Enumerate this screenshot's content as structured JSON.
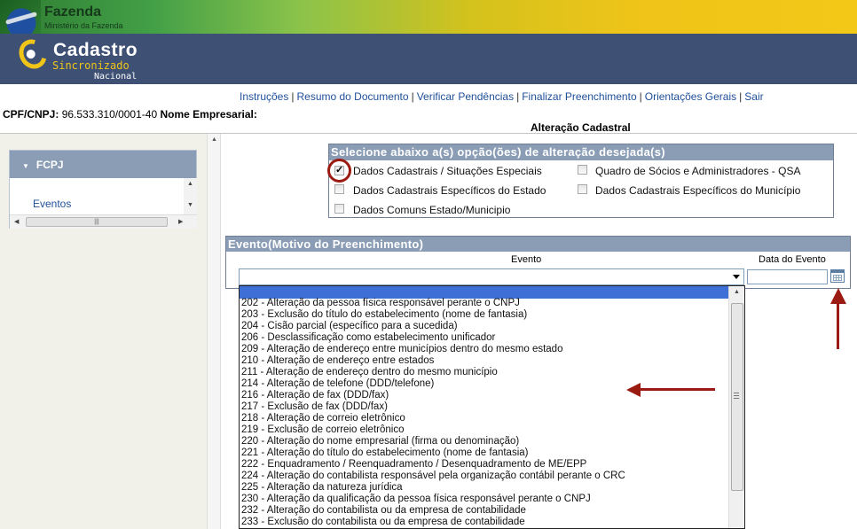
{
  "header": {
    "gov_title": "Fazenda",
    "gov_subtitle": "Ministério da Fazenda",
    "logo_line1": "Cadastro",
    "logo_line2": "Sincronizado",
    "logo_line3": "Nacional"
  },
  "nav": [
    "Instruções",
    "Resumo do Documento",
    "Verificar Pendências",
    "Finalizar Preenchimento",
    "Orientações Gerais",
    "Sair"
  ],
  "info": {
    "cpf_label": "CPF/CNPJ:",
    "cpf_value": "96.533.310/0001-40",
    "nome_label": "Nome Empresarial:",
    "page_subtitle": "Alteração Cadastral"
  },
  "sidebar": {
    "title": "FCPJ",
    "items": [
      "Eventos"
    ]
  },
  "options": {
    "title": "Selecione abaixo a(s) opção(ões) de alteração desejada(s)",
    "items": [
      {
        "label": "Dados Cadastrais / Situações Especiais",
        "checked": true
      },
      {
        "label": "Quadro de Sócios e Administradores - QSA",
        "checked": false
      },
      {
        "label": "Dados Cadastrais Específicos do Estado",
        "checked": false
      },
      {
        "label": "Dados Cadastrais Específicos do Município",
        "checked": false
      },
      {
        "label": "Dados Comuns Estado/Municipio",
        "checked": false
      }
    ]
  },
  "evento": {
    "title": "Evento(Motivo do Preenchimento)",
    "col_evento": "Evento",
    "col_data": "Data do Evento",
    "select_value": "",
    "date_value": "",
    "options": [
      "202 - Alteração da pessoa física responsável perante o CNPJ",
      "203 - Exclusão do título do estabelecimento (nome de fantasia)",
      "204 - Cisão parcial (específico para a sucedida)",
      "206 - Desclassificação como estabelecimento unificador",
      "209 - Alteração de endereço entre municípios dentro do mesmo estado",
      "210 - Alteração de endereço entre estados",
      "211 - Alteração de endereço dentro do mesmo município",
      "214 - Alteração de telefone (DDD/telefone)",
      "216 - Alteração de fax (DDD/fax)",
      "217 - Exclusão de fax (DDD/fax)",
      "218 - Alteração de correio eletrônico",
      "219 - Exclusão de correio eletrônico",
      "220 - Alteração do nome empresarial (firma ou denominação)",
      "221 - Alteração do título do estabelecimento (nome de fantasia)",
      "222 - Enquadramento / Reenquadramento / Desenquadramento de ME/EPP",
      "224 - Alteração do contabilista responsável pela organização contábil perante o CRC",
      "225 - Alteração da natureza jurídica",
      "230 - Alteração da qualificação da pessoa física responsável perante o CNPJ",
      "232 - Alteração do contabilista ou da empresa de contabilidade",
      "233 - Exclusão do contabilista ou da empresa de contabilidade"
    ]
  },
  "colors": {
    "panel_header": "#8a9db5",
    "link": "#1f4f9a",
    "annotation": "#9b1b12",
    "selection": "#3d6fd6"
  },
  "icons": [
    "scroll-up-icon",
    "scroll-down-icon",
    "calendar-icon",
    "dropdown-arrow-icon",
    "check-icon",
    "expand-triangle-icon"
  ]
}
